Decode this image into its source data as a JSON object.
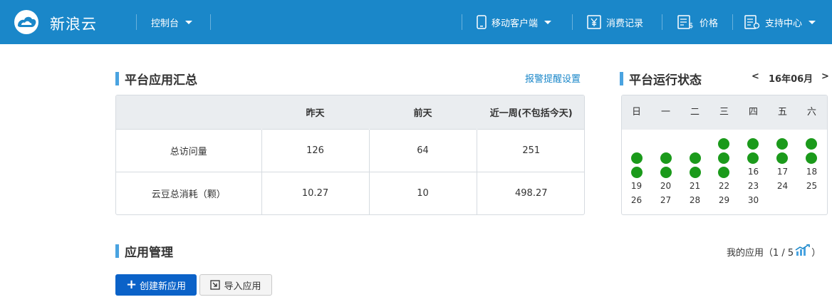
{
  "header": {
    "brand": "新浪云",
    "console_label": "控制台",
    "mobile_label": "移动客户端",
    "billing_label": "消费记录",
    "price_label": "价格",
    "support_label": "支持中心"
  },
  "summary": {
    "title": "平台应用汇总",
    "alert_link": "报警提醒设置",
    "columns": [
      "",
      "昨天",
      "前天",
      "近一周(不包括今天)"
    ],
    "rows": [
      {
        "label": "总访问量",
        "yesterday": "126",
        "day_before": "64",
        "week": "251"
      },
      {
        "label": "云豆总消耗（颗）",
        "yesterday": "10.27",
        "day_before": "10",
        "week": "498.27"
      }
    ]
  },
  "status": {
    "title": "平台运行状态",
    "prev": "<",
    "month": "16年06月",
    "next": ">",
    "weekdays": [
      "日",
      "一",
      "二",
      "三",
      "四",
      "五",
      "六"
    ],
    "days": [
      "16",
      "17",
      "18",
      "19",
      "20",
      "21",
      "22",
      "23",
      "24",
      "25",
      "26",
      "27",
      "28",
      "29",
      "30"
    ],
    "status_color": "#1b9a1b"
  },
  "apps": {
    "title": "应用管理",
    "my_apps_label": "我的应用",
    "count": "（1 / 5",
    "count_close": "）",
    "create_button": "创建新应用",
    "import_button": "导入应用"
  },
  "colors": {
    "header_bg": "#1a87c9",
    "accent_bar": "#4aa3e0",
    "primary_button": "#0b62c8"
  }
}
